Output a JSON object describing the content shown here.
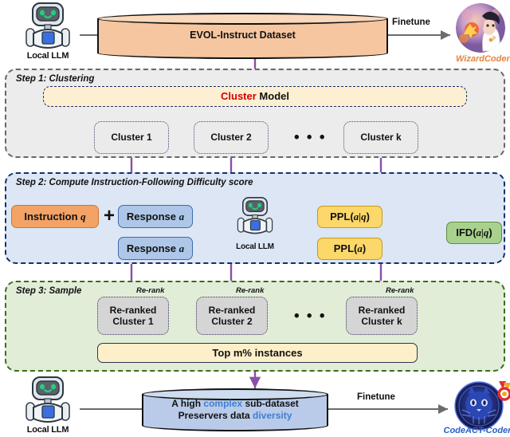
{
  "diagram": {
    "top": {
      "local_llm_label": "Local LLM",
      "dataset_label": "EVOL-Instruct Dataset",
      "finetune_label": "Finetune",
      "model_label": "WizardCoder",
      "dataset_fill": "#f5c6a0",
      "model_label_color": "#e8833a"
    },
    "step1": {
      "title": "Step 1: Clustering",
      "cluster_model": {
        "word_highlight": "Cluster",
        "word_rest": " Model",
        "highlight_color": "#d40000"
      },
      "clusters": [
        "Cluster 1",
        "Cluster 2",
        "Cluster k"
      ],
      "ellipsis": "• • •",
      "panel_fill": "#ececec"
    },
    "step2": {
      "title": "Step 2: Compute Instruction-Following Difficulty score",
      "instruction_box": {
        "text": "Instruction ",
        "symbol": "q"
      },
      "plus": "+",
      "response_box_top": {
        "text": "Response ",
        "symbol": "a"
      },
      "response_box_bottom": {
        "text": "Response ",
        "symbol": "a"
      },
      "local_llm_label": "Local LLM",
      "ppl_top": {
        "text": "PPL(",
        "symbol": "a|q",
        "close": ")"
      },
      "ppl_bottom": {
        "text": "PPL(",
        "symbol": "a",
        "close": ")"
      },
      "ifd": {
        "text": "IFD(",
        "symbol": "a|q",
        "close": ")"
      },
      "panel_fill": "#dce6f4"
    },
    "step3": {
      "title": "Step 3: Sample",
      "rerank_label": "Re-rank",
      "reranked_clusters": [
        {
          "line1": "Re-ranked",
          "line2": "Cluster 1"
        },
        {
          "line1": "Re-ranked",
          "line2": "Cluster 2"
        },
        {
          "line1": "Re-ranked",
          "line2": "Cluster k"
        }
      ],
      "ellipsis": "• • •",
      "top_instances": "Top m% instances",
      "panel_fill": "#e2edd8"
    },
    "bottom": {
      "local_llm_label": "Local LLM",
      "result_line1_a": "A high ",
      "result_line1_b": "complex",
      "result_line1_c": " sub-dataset",
      "result_line2_a": "Preservers data ",
      "result_line2_b": "diversity",
      "highlight_color": "#3d7fd6",
      "finetune_label": "Finetune",
      "model_label": "CodeACT-Coder",
      "model_label_color": "#2b5fc9",
      "dataset_fill": "#b9cbe8"
    }
  }
}
